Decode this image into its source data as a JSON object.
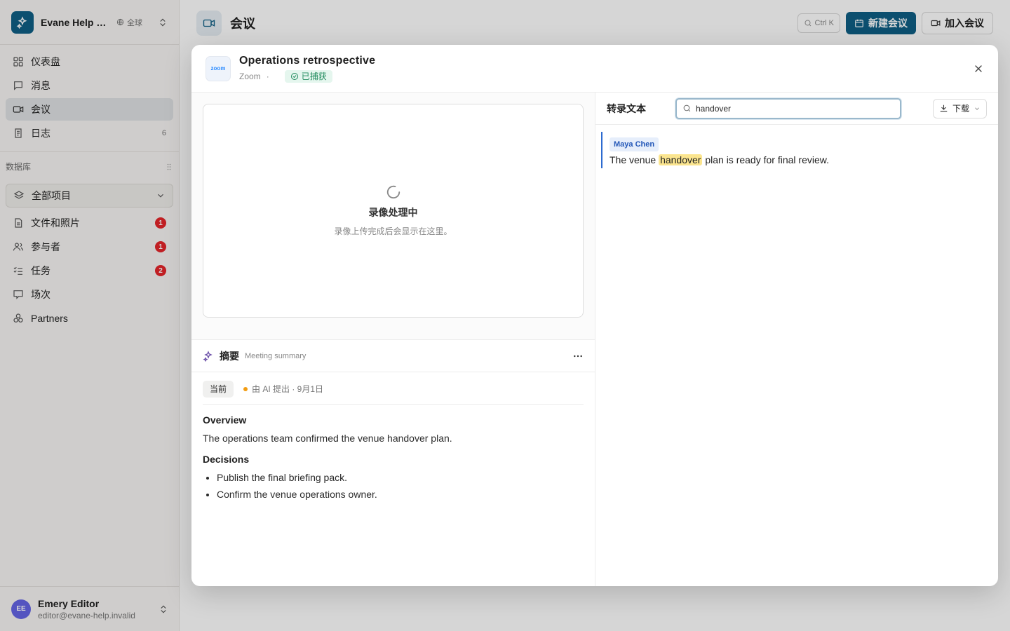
{
  "workspace": {
    "name": "Evane Help Center",
    "scope": "全球"
  },
  "nav": [
    {
      "label": "仪表盘",
      "icon": "dashboard-icon",
      "count": ""
    },
    {
      "label": "消息",
      "icon": "message-icon",
      "count": ""
    },
    {
      "label": "会议",
      "icon": "video-icon",
      "count": "",
      "active": true
    },
    {
      "label": "日志",
      "icon": "log-icon",
      "count": "6"
    }
  ],
  "database": {
    "heading": "数据库",
    "selected": "全部项目",
    "items": [
      {
        "label": "文件和照片",
        "icon": "file-icon",
        "badge": "1"
      },
      {
        "label": "参与者",
        "icon": "users-icon",
        "badge": "1"
      },
      {
        "label": "任务",
        "icon": "tasks-icon",
        "badge": "2"
      },
      {
        "label": "场次",
        "icon": "session-icon",
        "badge": ""
      },
      {
        "label": "Partners",
        "icon": "partners-icon",
        "badge": ""
      }
    ]
  },
  "user": {
    "initials": "EE",
    "name": "Emery Editor",
    "email": "editor@evane-help.invalid"
  },
  "page": {
    "title": "会议",
    "shortcut": "Ctrl K",
    "new_meeting": "新建会议",
    "join_meeting": "加入会议"
  },
  "dialog": {
    "title": "Operations retrospective",
    "provider": "Zoom",
    "provider_logo": "zoom",
    "status": "已捕获",
    "video": {
      "title": "录像处理中",
      "subtitle": "录像上传完成后会显示在这里。"
    },
    "summary": {
      "title": "摘要",
      "subtitle": "Meeting summary",
      "version_label": "当前",
      "version_info": "由 AI 提出 · 9月1日",
      "overview_heading": "Overview",
      "overview_text": "The operations team confirmed the venue handover plan.",
      "decisions_heading": "Decisions",
      "decisions": [
        "Publish the final briefing pack.",
        "Confirm the venue operations owner."
      ]
    },
    "transcript": {
      "title": "转录文本",
      "search_value": "handover",
      "download_label": "下载",
      "segments": [
        {
          "speaker": "Maya Chen",
          "before": "The venue ",
          "match": "handover",
          "after": " plan is ready for final review."
        }
      ]
    }
  },
  "colors": {
    "brand": "#0f5f85",
    "badge": "#e5252a",
    "highlight": "#fbe58f",
    "success": "#1f8a5c"
  }
}
